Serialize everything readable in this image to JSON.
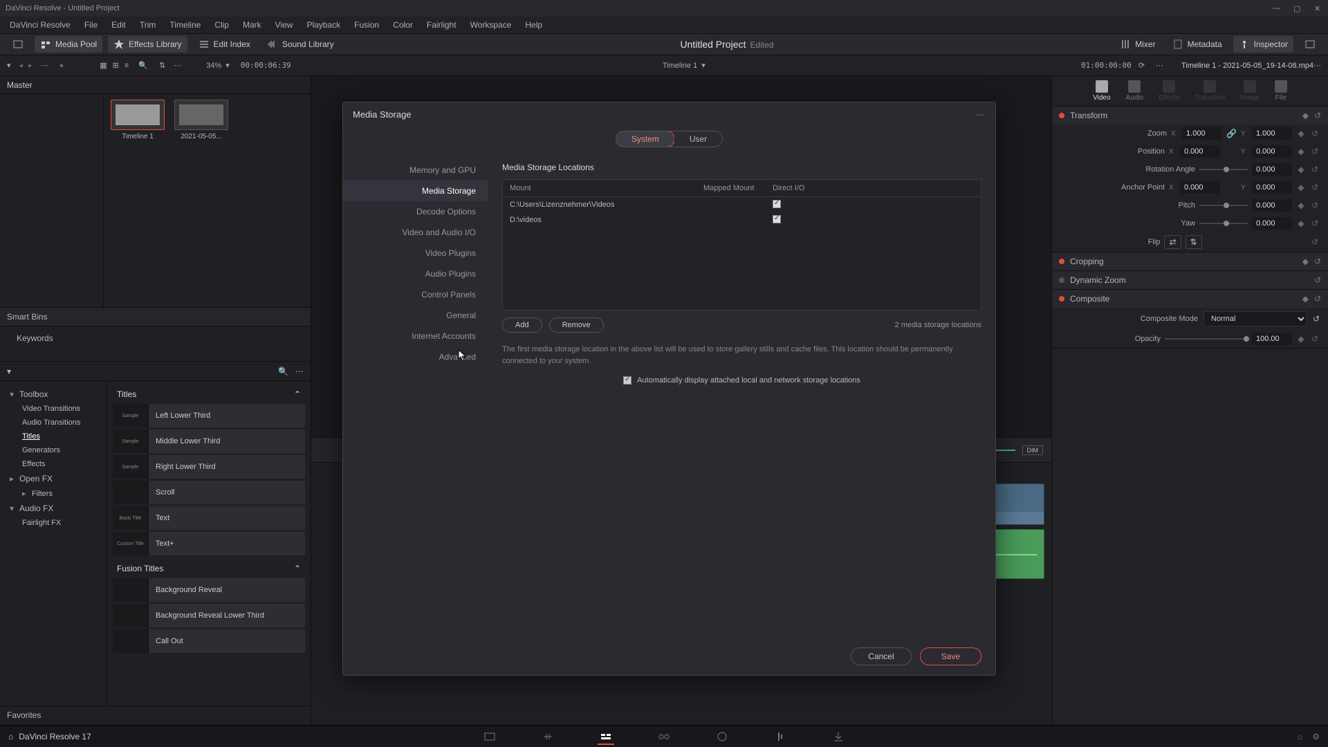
{
  "titlebar": {
    "text": "DaVinci Resolve - Untitled Project"
  },
  "menubar": [
    "DaVinci Resolve",
    "File",
    "Edit",
    "Trim",
    "Timeline",
    "Clip",
    "Mark",
    "View",
    "Playback",
    "Fusion",
    "Color",
    "Fairlight",
    "Workspace",
    "Help"
  ],
  "toolbar": {
    "media_pool": "Media Pool",
    "effects_library": "Effects Library",
    "edit_index": "Edit Index",
    "sound_library": "Sound Library",
    "mixer": "Mixer",
    "metadata": "Metadata",
    "inspector": "Inspector"
  },
  "project": {
    "title": "Untitled Project",
    "status": "Edited"
  },
  "secbar": {
    "zoom": "34%",
    "tc_left": "00:00:06:39",
    "timeline_name": "Timeline 1",
    "tc_right": "01:00:00:00",
    "clip_name": "Timeline 1 - 2021-05-05_19-14-08.mp4"
  },
  "pool": {
    "master": "Master",
    "clips": [
      {
        "name": "Timeline 1"
      },
      {
        "name": "2021-05-05..."
      }
    ],
    "smartbins": "Smart Bins",
    "keywords": "Keywords"
  },
  "fx": {
    "tree": {
      "toolbox": "Toolbox",
      "video_transitions": "Video Transitions",
      "audio_transitions": "Audio Transitions",
      "titles": "Titles",
      "generators": "Generators",
      "effects": "Effects",
      "openfx": "Open FX",
      "filters": "Filters",
      "audiofx": "Audio FX",
      "fairlightfx": "Fairlight FX"
    },
    "headers": {
      "titles": "Titles",
      "fusion_titles": "Fusion Titles"
    },
    "titles_items": [
      "Left Lower Third",
      "Middle Lower Third",
      "Right Lower Third",
      "Scroll",
      "Text",
      "Text+"
    ],
    "titles_thumbs": [
      "Sample",
      "Sample",
      "Sample",
      "",
      "Basic Title",
      "Custom Title"
    ],
    "fusion_items": [
      "Background Reveal",
      "Background Reveal Lower Third",
      "Call Out"
    ],
    "favorites": "Favorites"
  },
  "inspector": {
    "tabs": [
      "Video",
      "Audio",
      "Effects",
      "Transition",
      "Image",
      "File"
    ],
    "transform": {
      "title": "Transform",
      "zoom": "Zoom",
      "zoom_x": "1.000",
      "zoom_y": "1.000",
      "position": "Position",
      "pos_x": "0.000",
      "pos_y": "0.000",
      "rotation": "Rotation Angle",
      "rot_v": "0.000",
      "anchor": "Anchor Point",
      "anch_x": "0.000",
      "anch_y": "0.000",
      "pitch": "Pitch",
      "pitch_v": "0.000",
      "yaw": "Yaw",
      "yaw_v": "0.000",
      "flip": "Flip"
    },
    "cropping": "Cropping",
    "dynamic_zoom": "Dynamic Zoom",
    "composite": {
      "title": "Composite",
      "mode_label": "Composite Mode",
      "mode_value": "Normal",
      "opacity_label": "Opacity",
      "opacity_value": "100.00"
    }
  },
  "timeline_ctrl": {
    "dim": "DIM"
  },
  "bottom": {
    "app": "DaVinci Resolve 17"
  },
  "modal": {
    "title": "Media Storage",
    "tabs": {
      "system": "System",
      "user": "User"
    },
    "side": [
      "Memory and GPU",
      "Media Storage",
      "Decode Options",
      "Video and Audio I/O",
      "Video Plugins",
      "Audio Plugins",
      "Control Panels",
      "General",
      "Internet Accounts",
      "Advanced"
    ],
    "section_title": "Media Storage Locations",
    "cols": {
      "mount": "Mount",
      "mapped": "Mapped Mount",
      "direct": "Direct I/O"
    },
    "rows": [
      {
        "mount": "C:\\Users\\Lizenznehmer\\Videos"
      },
      {
        "mount": "D:\\videos"
      }
    ],
    "add": "Add",
    "remove": "Remove",
    "count": "2 media storage locations",
    "hint": "The first media storage location in the above list will be used to store gallery stills and cache files. This location should be permanently connected to your system.",
    "auto": "Automatically display attached local and network storage locations",
    "cancel": "Cancel",
    "save": "Save"
  }
}
